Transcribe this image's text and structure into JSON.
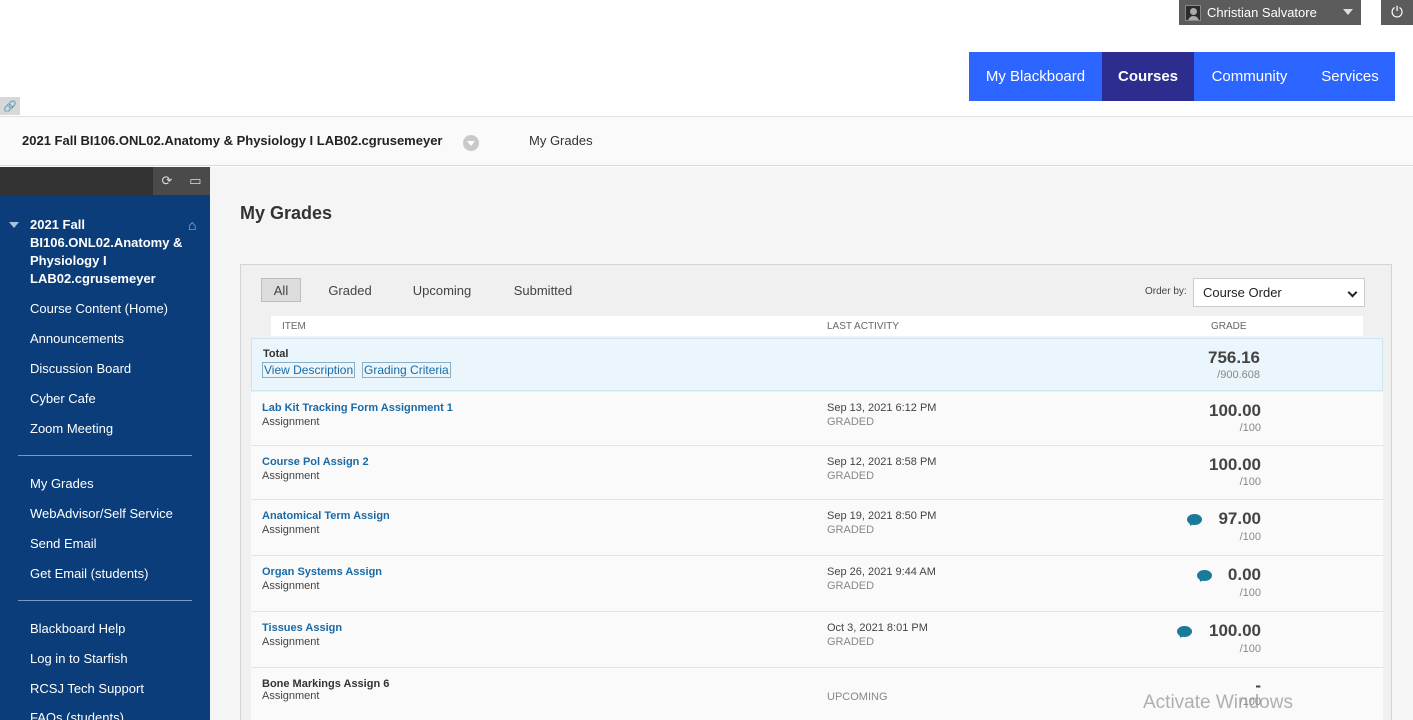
{
  "header": {
    "user_name": "Christian Salvatore",
    "nav_tabs": [
      {
        "label": "My Blackboard",
        "active": false
      },
      {
        "label": "Courses",
        "active": true
      },
      {
        "label": "Community",
        "active": false
      },
      {
        "label": "Services",
        "active": false
      }
    ]
  },
  "breadcrumb": {
    "course_title": "2021 Fall BI106.ONL02.Anatomy & Physiology I LAB02.cgrusemeyer",
    "current_page": "My Grades"
  },
  "sidebar": {
    "course_name": "2021 Fall BI106.ONL02.Anatomy & Physiology I LAB02.cgrusemeyer",
    "group1": [
      "Course Content (Home)",
      "Announcements",
      "Discussion Board",
      "Cyber Cafe",
      "Zoom Meeting"
    ],
    "group2": [
      "My Grades",
      "WebAdvisor/Self Service",
      "Send Email",
      "Get Email (students)"
    ],
    "group3": [
      "Blackboard Help",
      "Log in to Starfish",
      "RCSJ Tech Support",
      "FAQs (students)"
    ]
  },
  "main": {
    "page_title": "My Grades",
    "filters": [
      "All",
      "Graded",
      "Upcoming",
      "Submitted"
    ],
    "order_by_label": "Order by:",
    "order_by_value": "Course Order",
    "columns": {
      "item": "ITEM",
      "last_activity": "LAST ACTIVITY",
      "grade": "GRADE"
    },
    "total": {
      "label": "Total",
      "view_description": "View Description",
      "grading_criteria": "Grading Criteria",
      "score": "756.16",
      "max": "/900.608"
    },
    "rows": [
      {
        "title": "Lab Kit Tracking Form Assignment 1",
        "type": "Assignment",
        "date": "Sep 13, 2021 6:12 PM",
        "status": "GRADED",
        "score": "100.00",
        "max": "/100",
        "comment": false
      },
      {
        "title": "Course Pol Assign 2",
        "type": "Assignment",
        "date": "Sep 12, 2021 8:58 PM",
        "status": "GRADED",
        "score": "100.00",
        "max": "/100",
        "comment": false
      },
      {
        "title": "Anatomical Term Assign",
        "type": "Assignment",
        "date": "Sep 19, 2021 8:50 PM",
        "status": "GRADED",
        "score": "97.00",
        "max": "/100",
        "comment": true
      },
      {
        "title": "Organ Systems Assign",
        "type": "Assignment",
        "date": "Sep 26, 2021 9:44 AM",
        "status": "GRADED",
        "score": "0.00",
        "max": "/100",
        "comment": true
      },
      {
        "title": "Tissues Assign",
        "type": "Assignment",
        "date": "Oct 3, 2021 8:01 PM",
        "status": "GRADED",
        "score": "100.00",
        "max": "/100",
        "comment": true
      },
      {
        "title": "Bone Markings Assign 6",
        "type": "Assignment",
        "date": "",
        "status": "UPCOMING",
        "score": "-",
        "max": "/100",
        "comment": false
      }
    ]
  },
  "overlay": {
    "activate_windows": "Activate Windows"
  },
  "colors": {
    "nav_blue": "#2c65ff",
    "nav_active": "#2d2d8f",
    "sidebar_bg": "#0b3d7a",
    "link_blue": "#1a6aa6"
  }
}
